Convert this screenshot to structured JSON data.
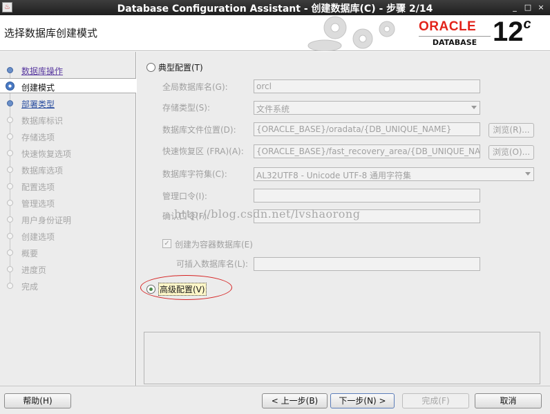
{
  "window": {
    "title": "Database Configuration Assistant - 创建数据库(C) - 步骤 2/14",
    "controls": [
      "_",
      "□",
      "×"
    ]
  },
  "header": {
    "page_title": "选择数据库创建模式",
    "brand": "ORACLE",
    "brand_sub": "DATABASE",
    "version": "12",
    "version_suffix": "c"
  },
  "sidebar": {
    "steps": [
      {
        "label": "数据库操作",
        "state": "done"
      },
      {
        "label": "创建模式",
        "state": "active"
      },
      {
        "label": "部署类型",
        "state": "link"
      },
      {
        "label": "数据库标识",
        "state": "pending"
      },
      {
        "label": "存储选项",
        "state": "pending"
      },
      {
        "label": "快速恢复选项",
        "state": "pending"
      },
      {
        "label": "数据库选项",
        "state": "pending"
      },
      {
        "label": "配置选项",
        "state": "pending"
      },
      {
        "label": "管理选项",
        "state": "pending"
      },
      {
        "label": "用户身份证明",
        "state": "pending"
      },
      {
        "label": "创建选项",
        "state": "pending"
      },
      {
        "label": "概要",
        "state": "pending"
      },
      {
        "label": "进度页",
        "state": "pending"
      },
      {
        "label": "完成",
        "state": "pending"
      }
    ]
  },
  "form": {
    "typical_label": "典型配置(T)",
    "typical_selected": false,
    "global_db_name_label": "全局数据库名(G):",
    "global_db_name_value": "orcl",
    "storage_type_label": "存储类型(S):",
    "storage_type_value": "文件系统",
    "db_file_location_label": "数据库文件位置(D):",
    "db_file_location_value": "{ORACLE_BASE}/oradata/{DB_UNIQUE_NAME}",
    "fra_label": "快速恢复区 (FRA)(A):",
    "fra_value": "{ORACLE_BASE}/fast_recovery_area/{DB_UNIQUE_NAME}",
    "browse1_label": "浏览(R)...",
    "browse2_label": "浏览(O)...",
    "charset_label": "数据库字符集(C):",
    "charset_value": "AL32UTF8 - Unicode UTF-8 通用字符集",
    "admin_pwd_label": "管理口令(I):",
    "confirm_pwd_label": "确认口令(F):",
    "container_db_label": "创建为容器数据库(E)",
    "container_db_checked": true,
    "pdb_name_label": "可插入数据库名(L):",
    "advanced_label": "高级配置(V)",
    "advanced_selected": true
  },
  "watermark": "http://blog.csdn.net/lvshaorong",
  "footer": {
    "help": "帮助(H)",
    "back": "< 上一步(B)",
    "next": "下一步(N) >",
    "finish": "完成(F)",
    "cancel": "取消"
  },
  "colors": {
    "oracle_red": "#e2231a",
    "annotation_red": "#d62020",
    "link_purple": "#5a3aa0"
  }
}
